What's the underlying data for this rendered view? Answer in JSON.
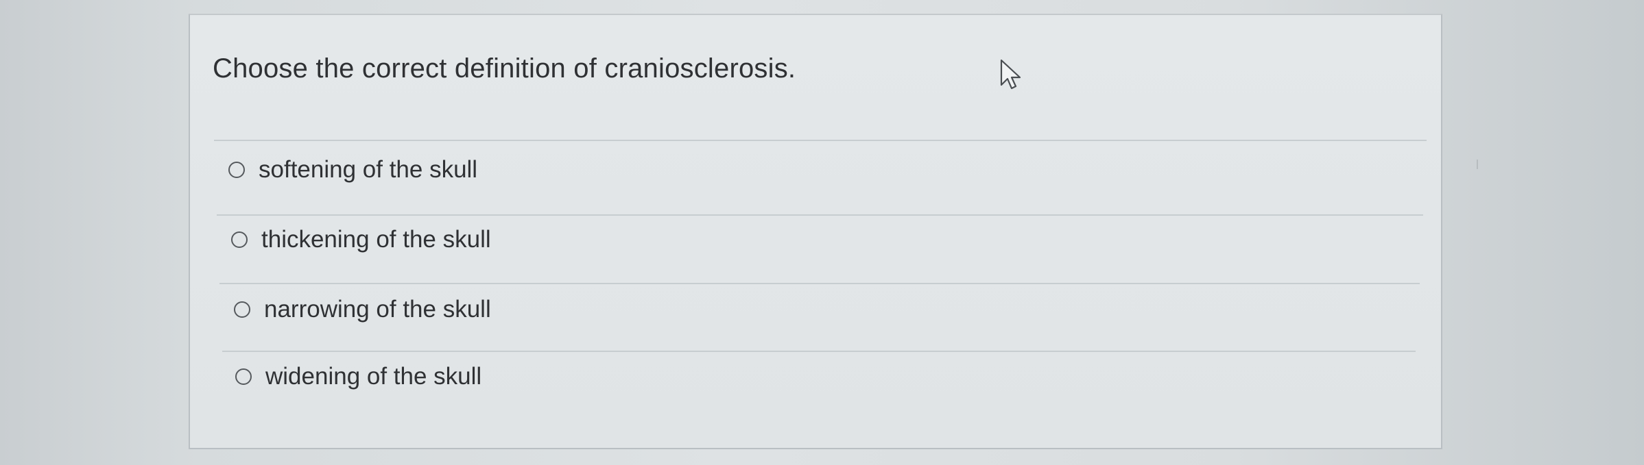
{
  "question": {
    "prompt": "Choose the correct definition of craniosclerosis.",
    "options": [
      {
        "label": "softening of the skull",
        "selected": false
      },
      {
        "label": "thickening of the skull",
        "selected": false
      },
      {
        "label": "narrowing of the skull",
        "selected": false
      },
      {
        "label": "widening of the skull",
        "selected": false
      }
    ]
  },
  "icons": {
    "cursor": "mouse-pointer-icon",
    "radio": "radio-button-icon"
  }
}
